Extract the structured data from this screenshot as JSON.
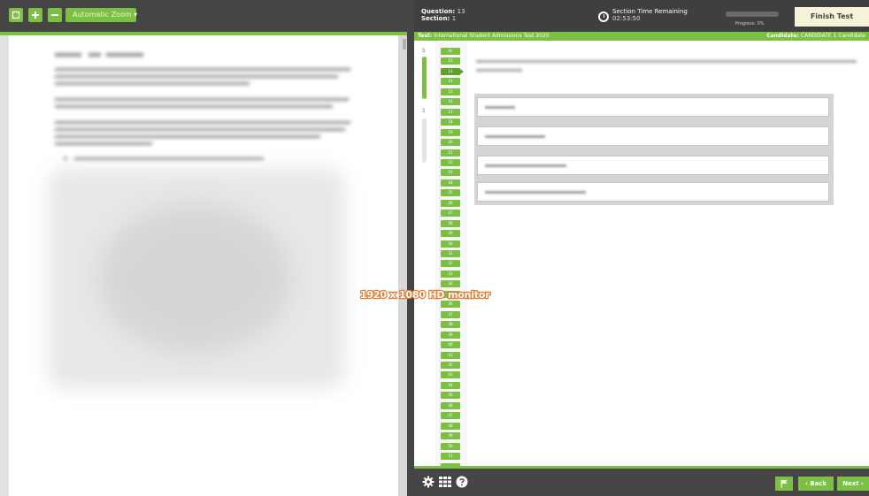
{
  "left_toolbar": {
    "icons": [
      "fullscreen-icon",
      "zoom-in-icon",
      "zoom-out-icon"
    ],
    "zoom_label": "Automatic Zoom ▾"
  },
  "header": {
    "question_label": "Question:",
    "question_value": "13",
    "section_label": "Section:",
    "section_value": "1",
    "time_label": "Section Time Remaining",
    "time_value": "02:53:50",
    "progress_label": "Progress: 0%",
    "progress_fraction": 0.0,
    "finish_label": "Finish Test"
  },
  "test_bar": {
    "test_label": "Test:",
    "test_name": "International Student Admissions Test 2020",
    "candidate_label": "Candidate:",
    "candidate_name": "CANDIDATE 1 Candidate"
  },
  "sections": [
    "S",
    "1"
  ],
  "question_nav": {
    "numbers": [
      "W",
      "12",
      "13",
      "14",
      "15",
      "16",
      "17",
      "18",
      "19",
      "20",
      "21",
      "22",
      "23",
      "24",
      "25",
      "26",
      "27",
      "28",
      "29",
      "30",
      "31",
      "32",
      "33",
      "34",
      "35",
      "36",
      "37",
      "38",
      "39",
      "40",
      "41",
      "42",
      "43",
      "44",
      "45",
      "46",
      "47",
      "48",
      "49",
      "50",
      "51"
    ],
    "current": "13"
  },
  "bottom_bar": {
    "icons": [
      "settings-gear-icon",
      "grid-icon",
      "help-icon",
      "flag-icon"
    ],
    "back_label": "‹ Back",
    "next_label": "Next ›"
  },
  "overlay": {
    "monitor_label": "1920 x 1080 HD monitor"
  },
  "colors": {
    "accent_green": "#7bc043",
    "header_dark": "#3f3f3f",
    "finish_button": "#f6f3d8",
    "overlay_orange": "#e07a2e"
  }
}
